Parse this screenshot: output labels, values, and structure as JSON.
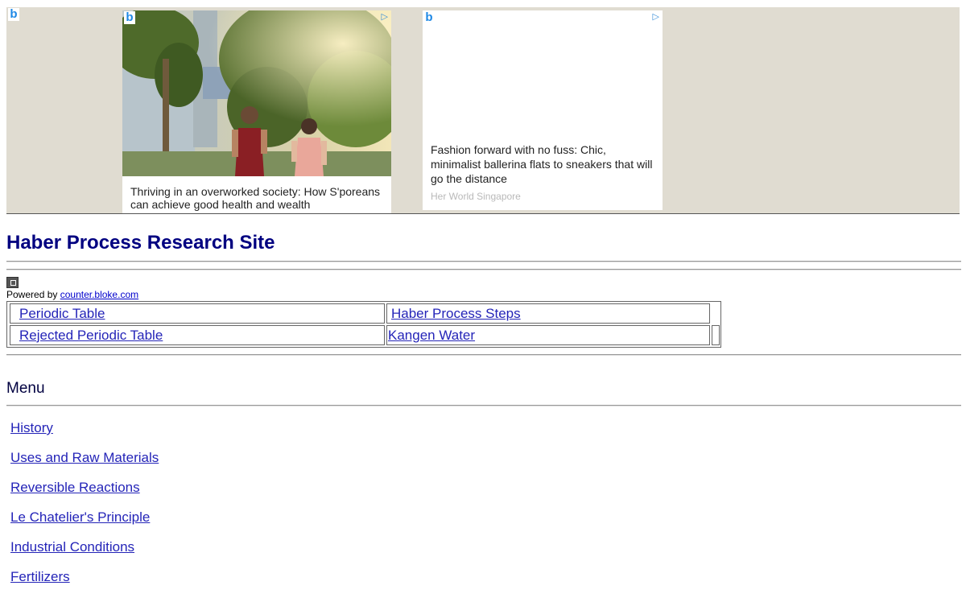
{
  "ads": {
    "logo_glyph": "b",
    "choices_glyph": "▷",
    "card_one": {
      "headline": "Thriving in an overworked society: How S'poreans can achieve good health and wealth"
    },
    "card_two": {
      "headline": "Fashion forward with no fuss: Chic, minimalist ballerina flats to sneakers that will go the distance",
      "source": "Her World Singapore"
    }
  },
  "header": {
    "title": "Haber Process Research Site"
  },
  "counter": {
    "powered_prefix": "Powered by",
    "link": "counter.bloke.com"
  },
  "links_table": {
    "periodic_table": "Periodic Table",
    "haber_steps": "Haber Process Steps",
    "rejected_periodic_table": "Rejected Periodic Table",
    "kangen_water": "Kangen Water"
  },
  "menu": {
    "heading": "Menu",
    "items": [
      "History",
      "Uses and Raw Materials",
      "Reversible Reactions",
      "Le Chatelier's Principle",
      "Industrial Conditions",
      "Fertilizers"
    ]
  },
  "colors": {
    "ad_background": "#e0dcd1",
    "title": "#000080",
    "link": "#2424b8"
  }
}
